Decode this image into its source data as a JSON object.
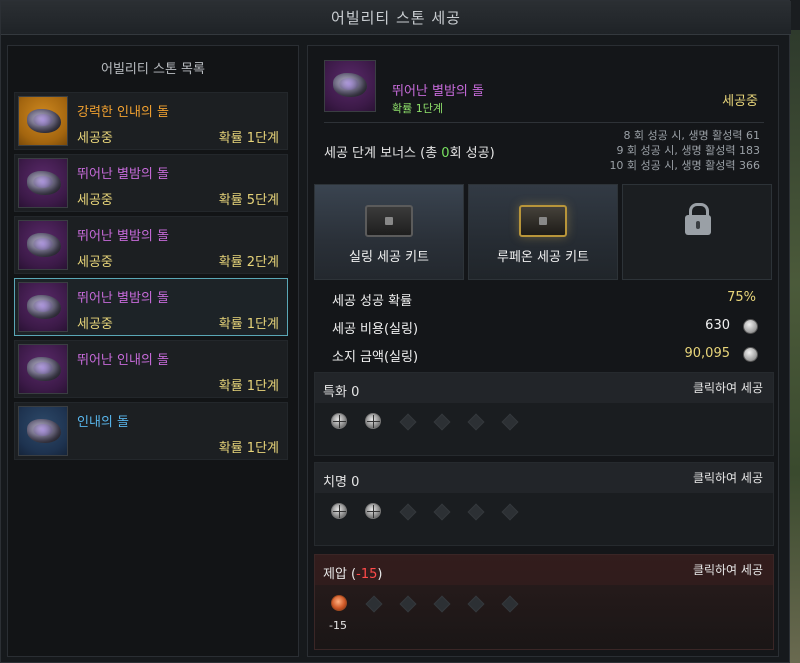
{
  "window": {
    "title": "어빌리티 스톤 세공"
  },
  "list": {
    "header": "어빌리티 스톤 목록",
    "items": [
      {
        "name": "강력한 인내의 돌",
        "status": "세공중",
        "prob": "확률 1단계",
        "color": "#f0a030",
        "icon": "ability-stone-orange"
      },
      {
        "name": "뛰어난 별밤의 돌",
        "status": "세공중",
        "prob": "확률 5단계",
        "color": "#c56ad8",
        "icon": "ability-stone-purple"
      },
      {
        "name": "뛰어난 별밤의 돌",
        "status": "세공중",
        "prob": "확률 2단계",
        "color": "#c56ad8",
        "icon": "ability-stone-purple"
      },
      {
        "name": "뛰어난 별밤의 돌",
        "status": "세공중",
        "prob": "확률 1단계",
        "color": "#c56ad8",
        "icon": "ability-stone-purple",
        "selected": true
      },
      {
        "name": "뛰어난 인내의 돌",
        "status": "",
        "prob": "확률 1단계",
        "color": "#c56ad8",
        "icon": "ability-stone-purple"
      },
      {
        "name": "인내의 돌",
        "status": "",
        "prob": "확률 1단계",
        "color": "#58b4ea",
        "icon": "ability-stone-blue"
      }
    ]
  },
  "selected": {
    "name": "뛰어난 별밤의 돌",
    "prob": "확률 1단계",
    "status": "세공중"
  },
  "bonus": {
    "title_prefix": "세공 단계 보너스 (총 ",
    "count": "0",
    "title_suffix": "회 성공)",
    "lines": [
      "8 회 성공 시, 생명 활성력 61",
      "9 회 성공 시, 생명 활성력 183",
      "10 회 성공 시, 생명 활성력 366"
    ]
  },
  "kits": [
    {
      "label": "실링 세공 키트",
      "icon": "silver-chest-icon"
    },
    {
      "label": "루페온 세공 키트",
      "icon": "gold-chest-icon"
    },
    {
      "label": "",
      "icon": "lock-icon"
    }
  ],
  "stats": {
    "success_label": "세공 성공 확률",
    "success_value": "75%",
    "cost_label": "세공 비용(실링)",
    "cost_value": "630",
    "owned_label": "소지 금액(실링)",
    "owned_value": "90,095"
  },
  "engravings": [
    {
      "name": "특화",
      "value": "0",
      "action": "클릭하여 세공",
      "slots": [
        "filled",
        "filled",
        "empty",
        "empty",
        "empty",
        "empty"
      ]
    },
    {
      "name": "치명",
      "value": "0",
      "action": "클릭하여 세공",
      "slots": [
        "filled",
        "filled",
        "empty",
        "empty",
        "empty",
        "empty"
      ]
    },
    {
      "name": "제압",
      "value": "-15",
      "action": "클릭하여 세공",
      "slots": [
        "negative",
        "empty",
        "empty",
        "empty",
        "empty",
        "empty"
      ],
      "caption": "-15"
    }
  ],
  "colors": {
    "accent_selected": "#5aa7b6",
    "gold_text": "#e8d57a",
    "negative": "#ff4a4a",
    "green": "#78e060"
  }
}
